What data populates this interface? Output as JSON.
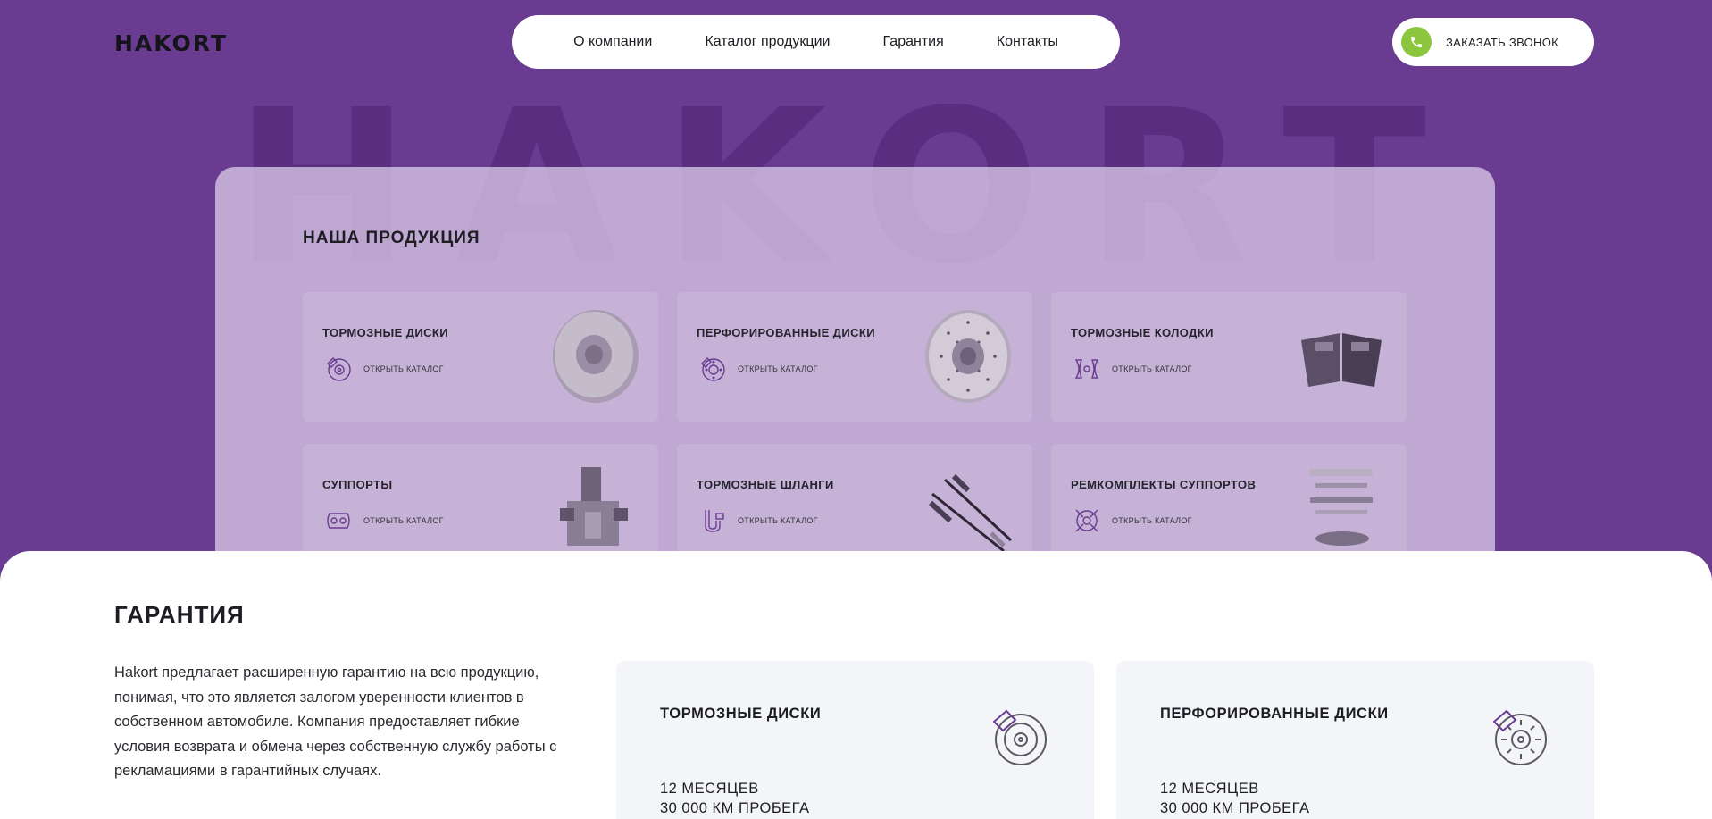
{
  "header": {
    "logo": "HAKORT",
    "nav": [
      "О компании",
      "Каталог продукции",
      "Гарантия",
      "Контакты"
    ],
    "call_button": "ЗАКАЗАТЬ ЗВОНОК"
  },
  "hero": {
    "watermark": "HAKORT"
  },
  "products": {
    "title": "НАША ПРОДУКЦИЯ",
    "link_label": "ОТКРЫТЬ КАТАЛОГ",
    "items": [
      {
        "title": "ТОРМОЗНЫЕ ДИСКИ",
        "icon": "brake-disc-icon",
        "image": "brake-disc-image"
      },
      {
        "title": "ПЕРФОРИРОВАННЫЕ ДИСКИ",
        "icon": "perforated-disc-icon",
        "image": "perforated-disc-image"
      },
      {
        "title": "ТОРМОЗНЫЕ КОЛОДКИ",
        "icon": "brake-pads-icon",
        "image": "brake-pads-image"
      },
      {
        "title": "СУППОРТЫ",
        "icon": "caliper-icon",
        "image": "caliper-image"
      },
      {
        "title": "ТОРМОЗНЫЕ ШЛАНГИ",
        "icon": "brake-hose-icon",
        "image": "brake-hose-image"
      },
      {
        "title": "РЕМКОМПЛЕКТЫ СУППОРТОВ",
        "icon": "repair-kit-icon",
        "image": "repair-kit-image"
      }
    ]
  },
  "warranty": {
    "title": "ГАРАНТИЯ",
    "text": "Hakort предлагает расширенную гарантию на всю продукцию, понимая, что это является залогом уверенности клиентов в собственном автомобиле. Компания предоставляет гибкие условия возврата и обмена через собственную службу работы с рекламациями в гарантийных случаях.",
    "cards": [
      {
        "title": "ТОРМОЗНЫЕ ДИСКИ",
        "months": "12 МЕСЯЦЕВ",
        "mileage": "30 000 КМ ПРОБЕГА"
      },
      {
        "title": "ПЕРФОРИРОВАННЫЕ ДИСКИ",
        "months": "12 МЕСЯЦЕВ",
        "mileage": "30 000 КМ ПРОБЕГА"
      }
    ]
  },
  "colors": {
    "background": "#6a3c91",
    "accent_purple": "#6a3c91",
    "call_green": "#8cc63f",
    "card_bg": "#f4f5f8"
  }
}
